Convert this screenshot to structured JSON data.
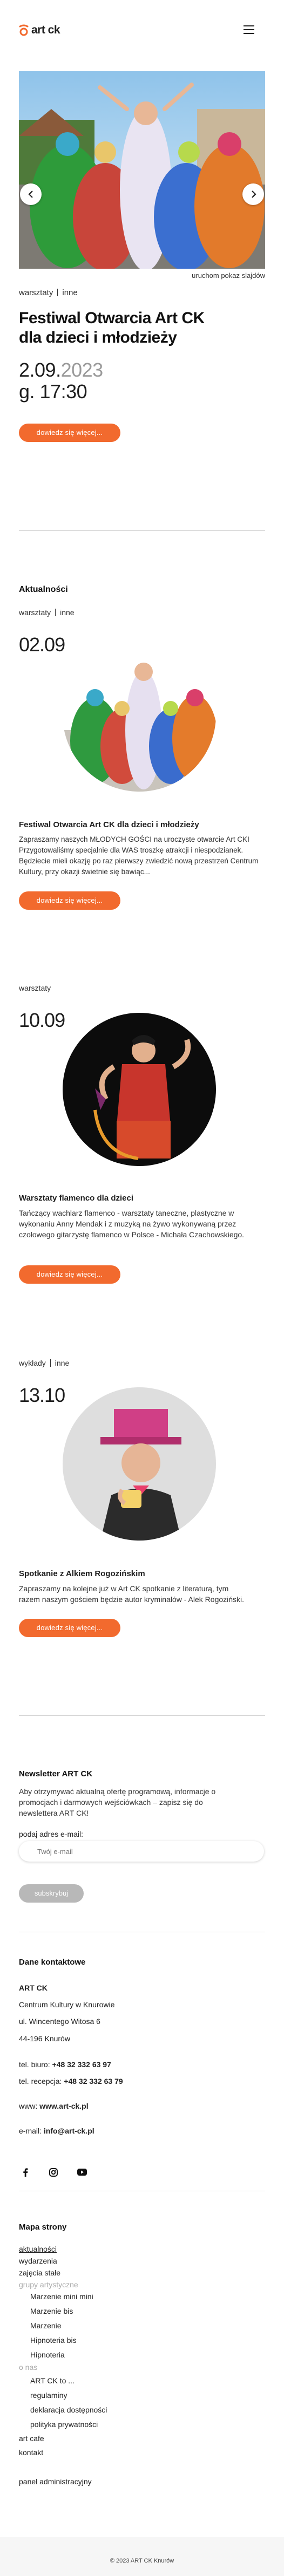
{
  "header": {
    "logo_text": "art ck",
    "menu_icon": "hamburger-icon"
  },
  "hero": {
    "slideshow_label": "uruchom pokaz slajdów",
    "category_1": "warsztaty",
    "category_2": "inne",
    "title_line1": "Festiwal Otwarcia Art CK",
    "title_line2": "dla dzieci i młodzieży",
    "date_main": "2.09.",
    "date_year": "2023",
    "time": "g. 17:30",
    "cta": "dowiedz się więcej..."
  },
  "news": {
    "section_title": "Aktualności",
    "items": [
      {
        "cat_1": "warsztaty",
        "cat_2": "inne",
        "date": "02.09",
        "title": "Festiwal Otwarcia Art CK dla dzieci i młodzieży",
        "desc": "Zapraszamy naszych MŁODYCH GOŚCI na uroczyste otwarcie Art CKI Przygotowaliśmy specjalnie dla WAS troszkę atrakcji i niespodzianek. Będziecie mieli okazję po raz pierwszy zwiedzić nową przestrzeń Centrum Kultury, przy okazji świetnie się bawiąc...",
        "cta": "dowiedz się więcej..."
      },
      {
        "cat_1": "warsztaty",
        "date": "10.09",
        "title": "Warsztaty flamenco dla dzieci",
        "desc": "Tańczący wachlarz flamenco - warsztaty taneczne, plastyczne w wykonaniu Anny Mendak i z muzyką na żywo wykonywaną przez czołowego gitarzystę flamenco w Polsce - Michała Czachowskiego.",
        "cta": "dowiedz się więcej..."
      },
      {
        "cat_1": "wykłady",
        "cat_2": "inne",
        "date": "13.10",
        "title": "Spotkanie z Alkiem Rogozińskim",
        "desc": "Zapraszamy na kolejne już w Art CK spotkanie z literaturą, tym razem naszym gościem będzie autor kryminałów - Alek Rogoziński.",
        "cta": "dowiedz się więcej..."
      }
    ]
  },
  "newsletter": {
    "title": "Newsletter ART CK",
    "desc": "Aby otrzymywać aktualną ofertę programową, informacje o promocjach i darmowych wejściówkach – zapisz się do newslettera ART CK!",
    "email_label": "podaj adres e-mail:",
    "email_placeholder": "Twój e-mail",
    "submit": "subskrybuj"
  },
  "contact": {
    "title": "Dane kontaktowe",
    "org": "ART CK",
    "line1": "Centrum Kultury w Knurowie",
    "line2": "ul. Wincentego Witosa 6",
    "line3": "44-196 Knurów",
    "phone_label": "tel. biuro: ",
    "phone": "+48 32 332 63 97",
    "phone2_label": "tel. recepcja: ",
    "phone2": "+48 32 332 63 79",
    "www_label": "www: ",
    "www": "www.art-ck.pl",
    "email_label": "e-mail: ",
    "email": "info@art-ck.pl"
  },
  "social": {
    "facebook": "facebook-icon",
    "instagram": "instagram-icon",
    "youtube": "youtube-icon"
  },
  "sitemap": {
    "title": "Mapa strony",
    "aktualnosci": "aktualności",
    "wydarzenia": "wydarzenia",
    "zajecia": "zajęcia stałe",
    "grupy": "grupy artystyczne",
    "g1": "Marzenie mini mini",
    "g2": "Marzenie bis",
    "g3": "Marzenie",
    "g4": "Hipnoteria bis",
    "g5": "Hipnoteria",
    "onas": "o nas",
    "o1": "ART CK to ...",
    "o2": "regulaminy",
    "o3": "deklaracja dostępności",
    "o4": "polityka prywatności",
    "artcafe": "art cafe",
    "kontakt": "kontakt",
    "panel": "panel administracyjny"
  },
  "footer": {
    "copyright": "© 2023 ART CK Knurów"
  },
  "colors": {
    "accent": "#f26a2e",
    "text": "#1e1e1e",
    "muted": "#aaaaaa"
  }
}
